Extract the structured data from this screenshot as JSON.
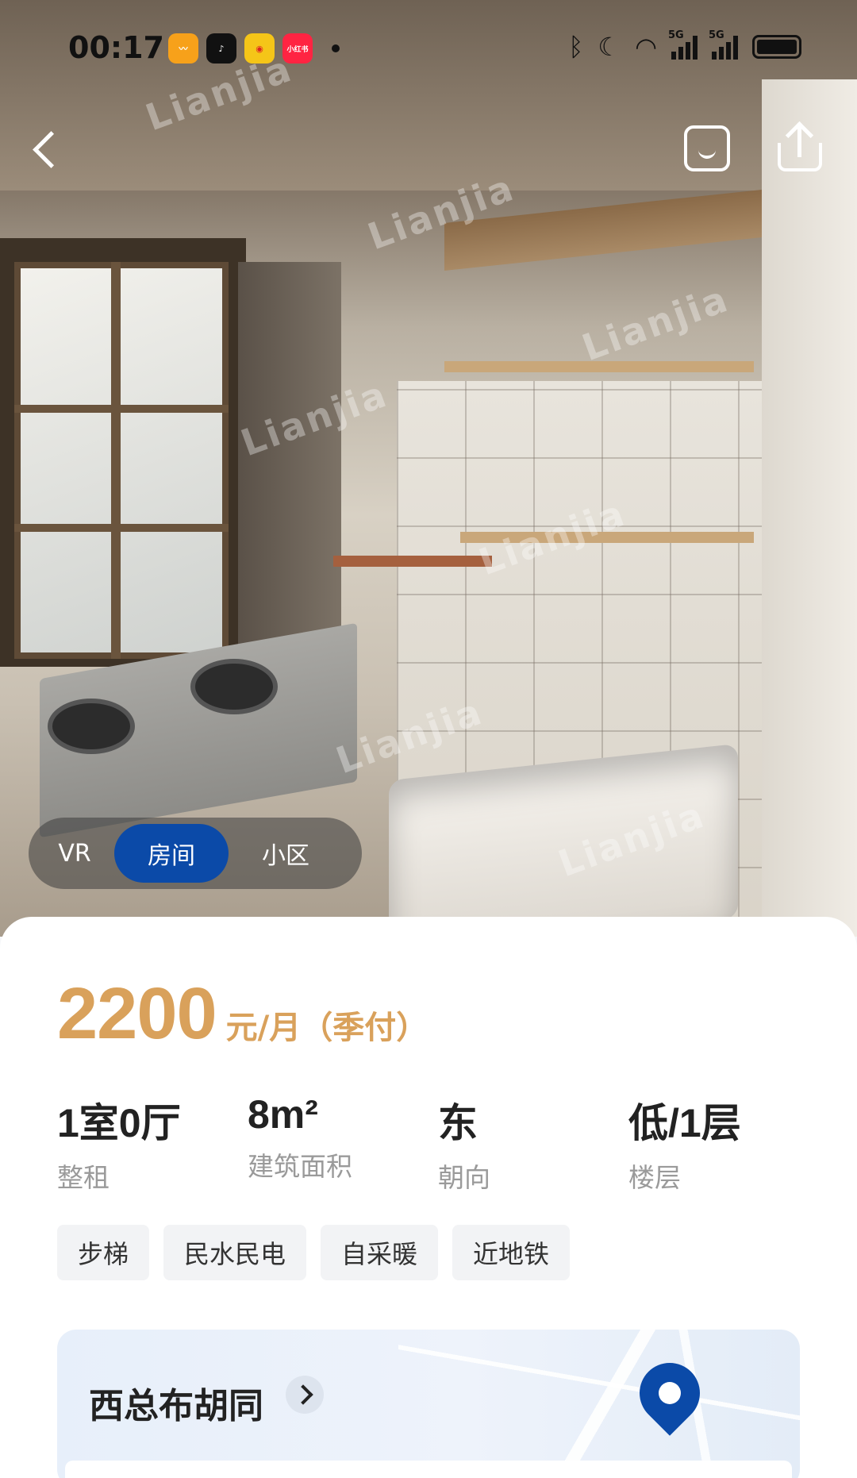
{
  "status_bar": {
    "time": "00:17",
    "apps": [
      {
        "name": "huolala",
        "color": "#f7a11a",
        "label": ""
      },
      {
        "name": "douyin",
        "color": "#111111",
        "label": "♪"
      },
      {
        "name": "weibo",
        "color": "#f5c518",
        "label": ""
      },
      {
        "name": "xiaohongshu",
        "color": "#ff2442",
        "label": "小红书"
      }
    ],
    "network": "5G"
  },
  "watermark": "Lianjia",
  "media_tabs": [
    {
      "label": "VR",
      "active": false
    },
    {
      "label": "房间",
      "active": true
    },
    {
      "label": "小区",
      "active": false
    }
  ],
  "price": {
    "amount": "2200",
    "unit": "元/月（季付）"
  },
  "specs": [
    {
      "value": "1室0厅",
      "label": "整租"
    },
    {
      "value": "8m²",
      "label": "建筑面积"
    },
    {
      "value": "东",
      "label": "朝向"
    },
    {
      "value": "低/1层",
      "label": "楼层"
    }
  ],
  "tags": [
    "步梯",
    "民水民电",
    "自采暖",
    "近地铁"
  ],
  "location": {
    "name": "西总布胡同"
  },
  "colors": {
    "price": "#d9a15b",
    "accent": "#0b4aa8"
  }
}
